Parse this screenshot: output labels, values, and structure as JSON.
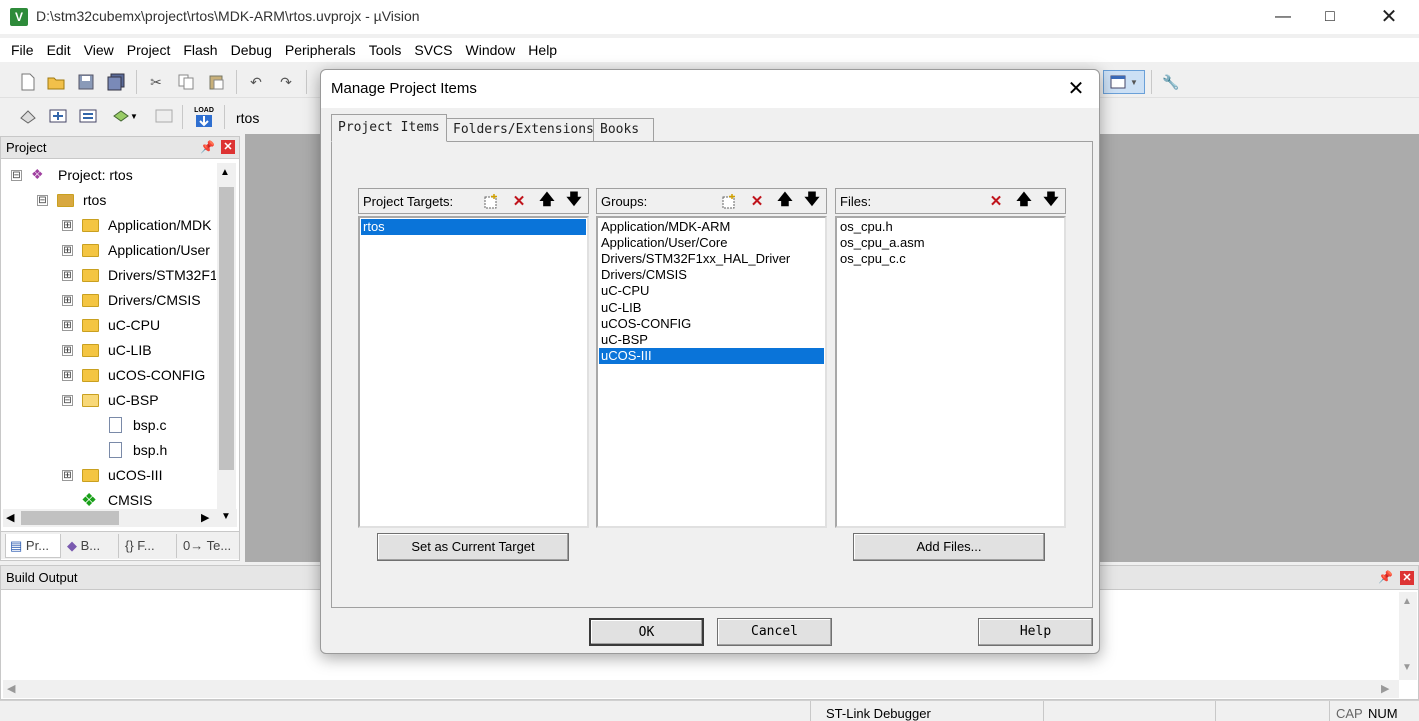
{
  "window": {
    "title": "D:\\stm32cubemx\\project\\rtos\\MDK-ARM\\rtos.uvprojx - µVision",
    "icon_letter": "V"
  },
  "menu": [
    "File",
    "Edit",
    "View",
    "Project",
    "Flash",
    "Debug",
    "Peripherals",
    "Tools",
    "SVCS",
    "Window",
    "Help"
  ],
  "toolbar2": {
    "target_name": "rtos",
    "load_label": "LOAD"
  },
  "project_panel": {
    "title": "Project",
    "tree": [
      {
        "label": "Project: rtos",
        "expander": "⊟"
      },
      {
        "label": "rtos",
        "expander": "⊟"
      },
      {
        "label": "Application/MDK",
        "expander": "⊞"
      },
      {
        "label": "Application/User",
        "expander": "⊞"
      },
      {
        "label": "Drivers/STM32F1",
        "expander": "⊞"
      },
      {
        "label": "Drivers/CMSIS",
        "expander": "⊞"
      },
      {
        "label": "uC-CPU",
        "expander": "⊞"
      },
      {
        "label": "uC-LIB",
        "expander": "⊞"
      },
      {
        "label": "uCOS-CONFIG",
        "expander": "⊞"
      },
      {
        "label": "uC-BSP",
        "expander": "⊟"
      },
      {
        "label": "bsp.c",
        "expander": ""
      },
      {
        "label": "bsp.h",
        "expander": ""
      },
      {
        "label": "uCOS-III",
        "expander": "⊞"
      },
      {
        "label": "CMSIS",
        "expander": ""
      }
    ],
    "tabs": [
      "Pr...",
      "B...",
      "{} F...",
      "0→ Te..."
    ]
  },
  "build_output": {
    "title": "Build Output"
  },
  "statusbar": {
    "debugger": "ST-Link Debugger",
    "cap": "CAP",
    "num": "NUM"
  },
  "dialog": {
    "title": "Manage Project Items",
    "tabs": [
      "Project Items",
      "Folders/Extensions",
      "Books"
    ],
    "targets": {
      "label": "Project Targets:",
      "items": [
        "rtos"
      ],
      "selected": 0
    },
    "groups": {
      "label": "Groups:",
      "items": [
        "Application/MDK-ARM",
        "Application/User/Core",
        "Drivers/STM32F1xx_HAL_Driver",
        "Drivers/CMSIS",
        "uC-CPU",
        "uC-LIB",
        "uCOS-CONFIG",
        "uC-BSP",
        "uCOS-III"
      ],
      "selected": 8
    },
    "files": {
      "label": "Files:",
      "items": [
        "os_cpu.h",
        "os_cpu_a.asm",
        "os_cpu_c.c"
      ]
    },
    "set_target_button": "Set as Current Target",
    "add_files_button": "Add Files...",
    "ok_button": "OK",
    "cancel_button": "Cancel",
    "help_button": "Help"
  },
  "colors": {
    "selection": "#0a74d9",
    "mdi_background": "#ababab",
    "delete_red": "#c0141c"
  }
}
